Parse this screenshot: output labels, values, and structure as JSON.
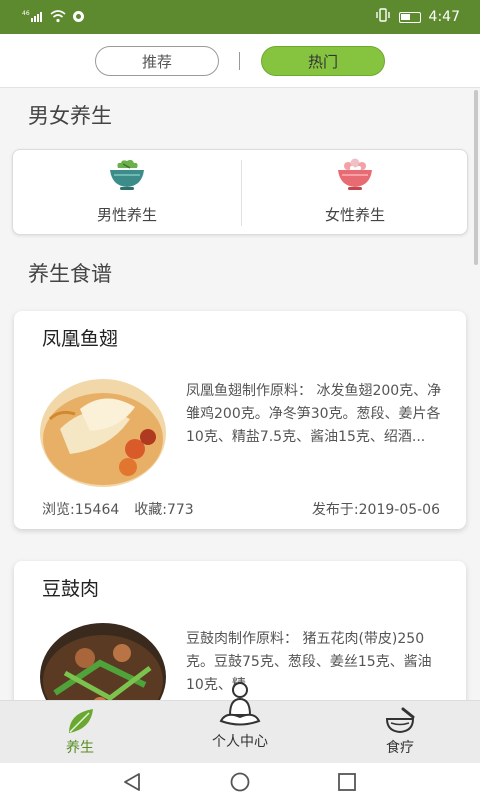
{
  "status_bar": {
    "signal_label": "⁴⁶",
    "icons_left": [
      "signal-icon",
      "wifi-icon",
      "sync-icon"
    ],
    "icons_right": [
      "vibrate-icon",
      "battery-icon"
    ],
    "time": "4:47",
    "background": "#5d8a2e"
  },
  "tabs": {
    "items": [
      {
        "label": "推荐",
        "active": false
      },
      {
        "label": "热门",
        "active": true
      }
    ],
    "active_color": "#86c440"
  },
  "sections": {
    "health_title": "男女养生",
    "recipes_title": "养生食谱"
  },
  "health": {
    "items": [
      {
        "label": "男性养生",
        "icon": "male-bowl-icon"
      },
      {
        "label": "女性养生",
        "icon": "female-bowl-icon"
      }
    ]
  },
  "recipes": [
    {
      "title": "凤凰鱼翅",
      "description": "凤凰鱼翅制作原料： 冰发鱼翅200克、净雏鸡200克。净冬笋30克。葱段、姜片各10克、精盐7.5克、酱油15克、绍酒...",
      "views": "浏览:15464",
      "favorites": "收藏:773",
      "published": "发布于:2019-05-06"
    },
    {
      "title": "豆鼓肉",
      "description": "豆鼓肉制作原料： 猪五花肉(带皮)250克。豆鼓75克、葱段、姜丝15克、酱油10克、精"
    }
  ],
  "bottom_nav": {
    "items": [
      {
        "label": "养生",
        "icon": "leaf-icon",
        "active": true
      },
      {
        "label": "个人中心",
        "icon": "meditation-person-icon",
        "active": false
      },
      {
        "label": "食疗",
        "icon": "mortar-pestle-icon",
        "active": false
      }
    ],
    "active_color": "#5a8e25"
  },
  "system_nav": {
    "icons": [
      "back-icon",
      "home-icon",
      "recents-icon"
    ]
  }
}
